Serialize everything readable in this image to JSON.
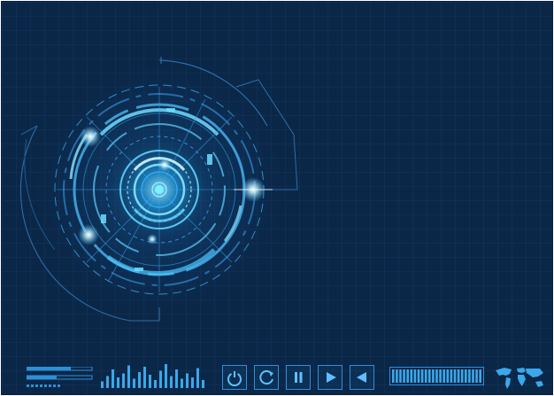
{
  "theme": {
    "background": "#0b2748",
    "accent": "#2d8fd8",
    "glow": "#7fe3ff"
  },
  "hud": {
    "icon": "radar-target-icon"
  },
  "controls": {
    "level_bar": "level-bar-icon",
    "equalizer": "equalizer-icon",
    "power": "power-icon",
    "refresh": "refresh-icon",
    "pause": "pause-icon",
    "play": "play-icon",
    "back": "back-icon",
    "progress": "segmented-progress-icon",
    "map": "world-map-icon"
  },
  "equalizer_levels": [
    0.25,
    0.45,
    0.7,
    0.4,
    0.55,
    0.85,
    0.35,
    0.6,
    0.8,
    0.5,
    0.3,
    0.65,
    0.9,
    0.45,
    0.7,
    0.35,
    0.55,
    0.4,
    0.75,
    0.3
  ]
}
